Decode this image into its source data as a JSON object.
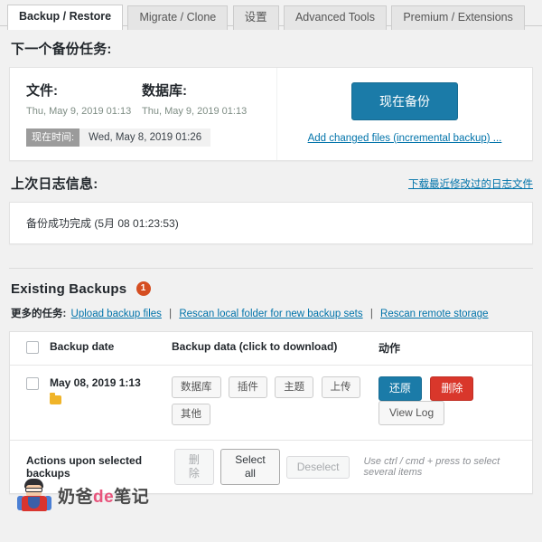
{
  "tabs": [
    {
      "label": "Backup / Restore",
      "active": true
    },
    {
      "label": "Migrate / Clone",
      "active": false
    },
    {
      "label": "设置",
      "active": false
    },
    {
      "label": "Advanced Tools",
      "active": false
    },
    {
      "label": "Premium / Extensions",
      "active": false
    }
  ],
  "next_backup": {
    "heading": "下一个备份任务:",
    "files": {
      "title": "文件:",
      "date": "Thu, May 9, 2019 01:13"
    },
    "database": {
      "title": "数据库:",
      "date": "Thu, May 9, 2019 01:13"
    },
    "now": {
      "label": "现在时间:",
      "value": "Wed, May 8, 2019 01:26"
    },
    "backup_now_label": "现在备份",
    "incremental_link": "Add changed files (incremental backup) ...",
    "accent_color": "#1b7ba8"
  },
  "last_log": {
    "heading": "上次日志信息:",
    "download_link": "下载最近修改过的日志文件",
    "message": "备份成功完成 (5月 08 01:23:53)"
  },
  "existing_backups": {
    "heading": "Existing Backups",
    "count": "1",
    "count_color": "#d54e21",
    "more_tasks_label": "更多的任务:",
    "more_tasks_links": [
      "Upload backup files",
      "Rescan local folder for new backup sets",
      "Rescan remote storage"
    ],
    "separator": "|",
    "table": {
      "headers": [
        "",
        "Backup date",
        "Backup data (click to download)",
        "动作"
      ],
      "rows": [
        {
          "date": "May 08, 2019 1:13",
          "data_chips": [
            "数据库",
            "插件",
            "主题",
            "上传",
            "其他"
          ],
          "actions": [
            {
              "label": "还原",
              "style": "blue"
            },
            {
              "label": "删除",
              "style": "red"
            },
            {
              "label": "View Log",
              "style": "white"
            }
          ]
        }
      ]
    },
    "action_bar": {
      "label": "Actions upon selected backups",
      "delete_label": "删除",
      "select_all_label": "Select all",
      "deselect_label": "Deselect",
      "hint": "Use ctrl / cmd + press to select several items"
    }
  },
  "watermark": {
    "text_part1": "奶爸",
    "text_de": "de",
    "text_part2": "笔记"
  }
}
